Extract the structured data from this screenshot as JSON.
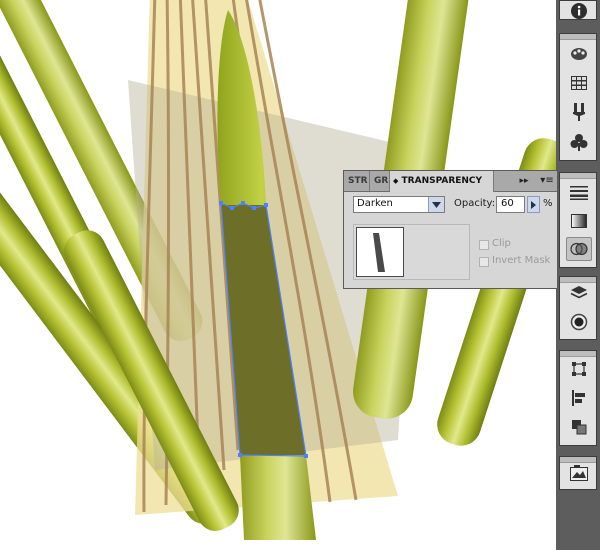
{
  "panel": {
    "tabs": [
      {
        "label": "STR"
      },
      {
        "label": "GR"
      },
      {
        "label": "TRANSPARENCY"
      }
    ],
    "blend_mode": "Darken",
    "opacity_label": "Opacity:",
    "opacity_value": "60",
    "percent": "%",
    "clip_label": "Clip",
    "invert_mask_label": "Invert Mask"
  },
  "dock": {
    "tools": [
      "info-icon",
      "color-guide-icon",
      "swatches-icon",
      "brushes-icon",
      "symbols-icon",
      "stroke-icon",
      "gradient-icon",
      "transparency-icon",
      "layers-icon",
      "appearance-icon",
      "transform-icon",
      "align-icon",
      "pathfinder-icon",
      "links-icon"
    ],
    "active_tool": "transparency-icon"
  },
  "colors": {
    "grass_dark": "#7f8c1a",
    "grass_light": "#d9e27a",
    "selection": "#4d7fff",
    "sheath": "#e9d889",
    "vein": "#9f7f4c"
  }
}
